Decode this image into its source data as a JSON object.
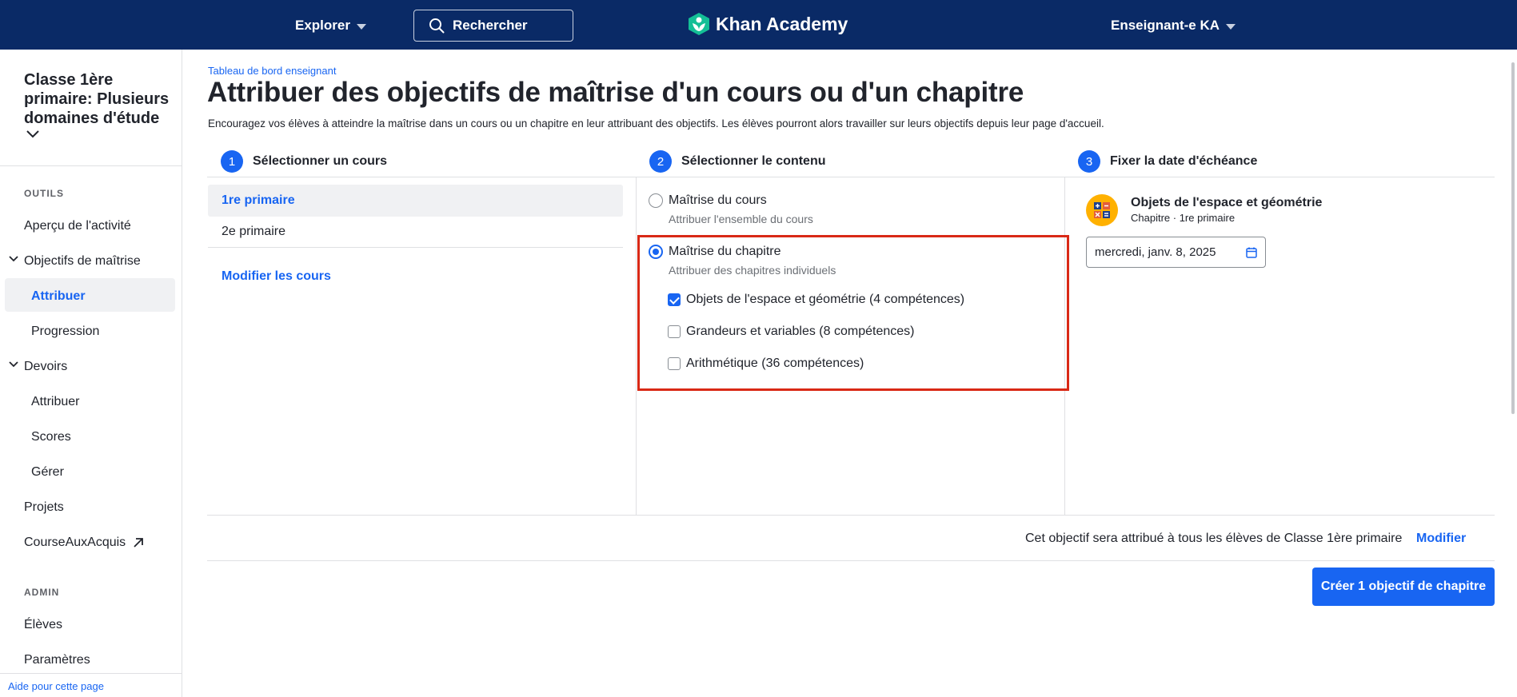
{
  "topbar": {
    "explore_label": "Explorer",
    "search_placeholder": "Rechercher",
    "logo_text": "Khan Academy",
    "user_label": "Enseignant-e KA"
  },
  "sidebar": {
    "class_title": "Classe 1ère primaire: Plusieurs domaines d'étude",
    "section_tools": "OUTILS",
    "items": {
      "activity": "Aperçu de l'activité",
      "mastery_goals": "Objectifs de maîtrise",
      "assign": "Attribuer",
      "progress": "Progression",
      "assignments": "Devoirs",
      "assign2": "Attribuer",
      "scores": "Scores",
      "manage": "Gérer",
      "projects": "Projets",
      "course_challenge": "CourseAuxAcquis"
    },
    "section_admin": "ADMIN",
    "admin_items": {
      "students": "Élèves",
      "settings": "Paramètres"
    },
    "help_link": "Aide pour cette page"
  },
  "main": {
    "breadcrumb": "Tableau de bord enseignant",
    "title": "Attribuer des objectifs de maîtrise d'un cours ou d'un chapitre",
    "description": "Encouragez vos élèves à atteindre la maîtrise dans un cours ou un chapitre en leur attribuant des objectifs. Les élèves pourront alors travailler sur leurs objectifs depuis leur page d'accueil.",
    "steps": [
      {
        "num": "1",
        "label": "Sélectionner un cours"
      },
      {
        "num": "2",
        "label": "Sélectionner le contenu"
      },
      {
        "num": "3",
        "label": "Fixer la date d'échéance"
      }
    ],
    "courses": [
      "1re primaire",
      "2e primaire"
    ],
    "modify_courses": "Modifier les cours",
    "content": {
      "course_mastery": {
        "title": "Maîtrise du cours",
        "subtitle": "Attribuer l'ensemble du cours"
      },
      "unit_mastery": {
        "title": "Maîtrise du chapitre",
        "subtitle": "Attribuer des chapitres individuels"
      },
      "units": [
        {
          "label": "Objets de l'espace et géométrie (4 compétences)",
          "checked": true
        },
        {
          "label": "Grandeurs et variables (8 compétences)",
          "checked": false
        },
        {
          "label": "Arithmétique (36 compétences)",
          "checked": false
        }
      ]
    },
    "due": {
      "unit_title": "Objets de l'espace et géométrie",
      "unit_subtitle": "Chapitre · 1re primaire",
      "date_value": "mercredi, janv. 8, 2025"
    },
    "assign_note": "Cet objectif sera attribué à tous les élèves de Classe 1ère primaire",
    "modify_label": "Modifier",
    "create_button": "Créer 1 objectif de chapitre"
  },
  "colors": {
    "topbar": "#0a2a66",
    "accent": "#1865f2",
    "highlight": "#d92916",
    "unit_icon": "#ffb100"
  }
}
